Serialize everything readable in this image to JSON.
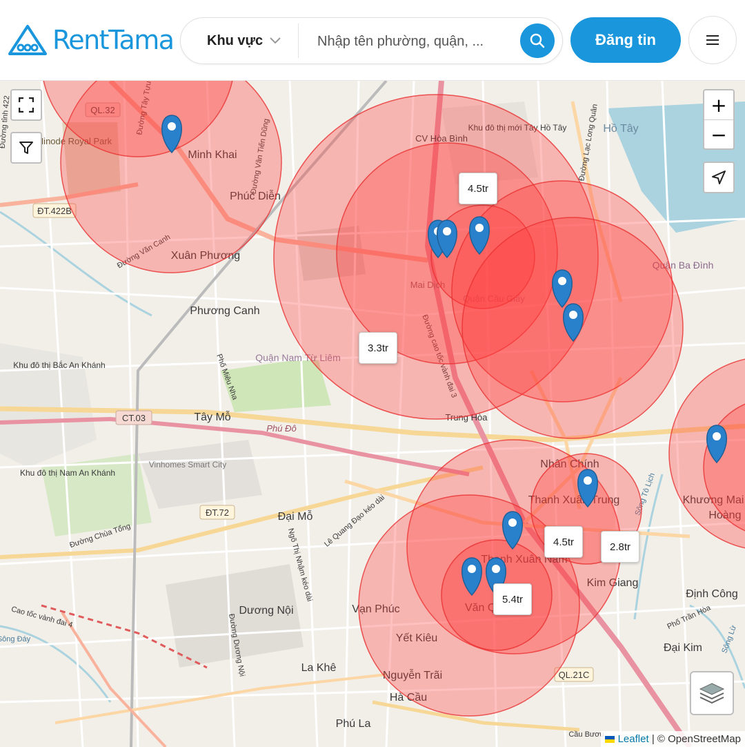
{
  "header": {
    "logo_text": "RentTama",
    "region_label": "Khu vực",
    "search_placeholder": "Nhập tên phường, quận, ...",
    "post_button": "Đăng tin",
    "icons": [
      "logo-house-icon",
      "chevron-down-icon",
      "search-icon",
      "hamburger-menu-icon"
    ]
  },
  "map": {
    "controls": {
      "zoom_in": "+",
      "zoom_out": "−",
      "icons": [
        "fullscreen-icon",
        "filter-icon",
        "locate-icon",
        "layers-icon"
      ]
    },
    "prices": [
      "4.5tr",
      "3.3tr",
      "4.5tr",
      "2.8tr",
      "5.4tr"
    ],
    "place_labels": [
      "Minh Khai",
      "Phúc Diễn",
      "Xuân Phương",
      "Phương Canh",
      "Tây Mỗ",
      "Đại Mỗ",
      "Dương Nội",
      "Vạn Phúc",
      "Yết Kiêu",
      "La Khê",
      "Nguyễn Trãi",
      "Hà Cầu",
      "Phú La",
      "Nhân Chính",
      "Thanh Xuân Trung",
      "Thanh Xuân Nam",
      "Kim Giang",
      "Định Công",
      "Đại Kim",
      "Khương Mai",
      "Hồ Tây",
      "Quận Ba Đình",
      "CV Hòa Bình",
      "Khu đô thị Bắc An Khánh",
      "Khu đô thị Nam An Khánh",
      "Hinode Royal Park",
      "Vinhomes Smart City",
      "Quận Nam Từ Liêm",
      "Quận Cầu Giấy",
      "Mai Dịch",
      "Trung Hòa",
      "Khu đô thị mới Tây Hồ Tây",
      "Văn Quán",
      "Hoàng Mai"
    ],
    "road_labels": [
      "QL.32",
      "ĐT.422B",
      "CT.03",
      "ĐT.72",
      "QL.21C",
      "Phú Đô",
      "Đường Văn Canh",
      "Đường Vân Tiến Dũng",
      "Phố Miêu Nha",
      "Đường Chùa Tổng",
      "Lê Quang Đạo kéo dài",
      "Ngõ Thị Nhậm kéo dài",
      "Đường Dương Nội",
      "Đường cao tốc vành đai 3",
      "Phố Trần Hòa",
      "Đường Lạc Long Quân",
      "Cao tốc vành đai 4",
      "Đường tỉnh 422",
      "Đường Tây Tựu",
      "Sông Tô Lịch",
      "Sông Đáy",
      "Sông Lừ",
      "Cầu Bươu"
    ],
    "attribution": {
      "leaflet": "Leaflet",
      "rest": "| © OpenStreetMap"
    }
  }
}
